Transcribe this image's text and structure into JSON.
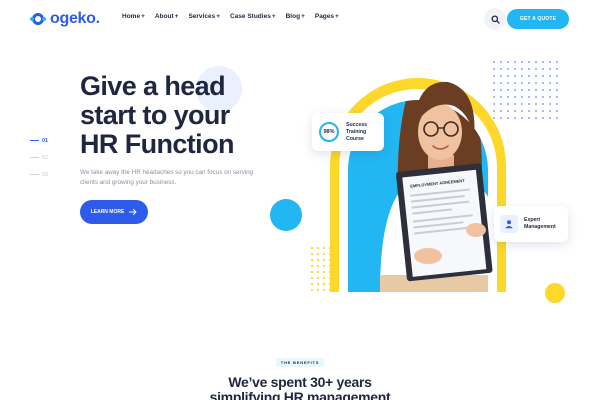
{
  "brand": {
    "name": "ogeko."
  },
  "nav": {
    "items": [
      {
        "label": "Home",
        "icon": "plus-icon"
      },
      {
        "label": "About",
        "icon": "plus-icon"
      },
      {
        "label": "Services",
        "icon": "plus-icon"
      },
      {
        "label": "Case Studies",
        "icon": "plus-icon"
      },
      {
        "label": "Blog",
        "icon": "plus-icon"
      },
      {
        "label": "Pages",
        "icon": "plus-icon"
      }
    ],
    "quote_label": "GET A QUOTE"
  },
  "hero": {
    "title": "Give a head start to your HR Function",
    "description": "We take away the HR headaches so you can focus on serving clients and growing your business.",
    "cta_label": "LEARN MORE"
  },
  "slider": {
    "items": [
      "01",
      "02",
      "03"
    ],
    "active_index": 0
  },
  "badges": {
    "training": {
      "value": "98%",
      "fraction": 0.98,
      "label_lines": [
        "Success",
        "Training",
        "Course"
      ]
    },
    "expert": {
      "label_lines": [
        "Expert",
        "Management"
      ],
      "icon": "person-icon"
    }
  },
  "illustration": {
    "document_title": "EMPLOYMENT AGREEMENT"
  },
  "benefits": {
    "tag": "THE BENEFITS",
    "title_lines": [
      "We’ve spent 30+ years",
      "simplifying HR management"
    ]
  },
  "colors": {
    "primary": "#2f5bea",
    "accent": "#22b6f2",
    "yellow": "#fdd82a",
    "heading": "#1f2640",
    "muted": "#8a90a2"
  }
}
